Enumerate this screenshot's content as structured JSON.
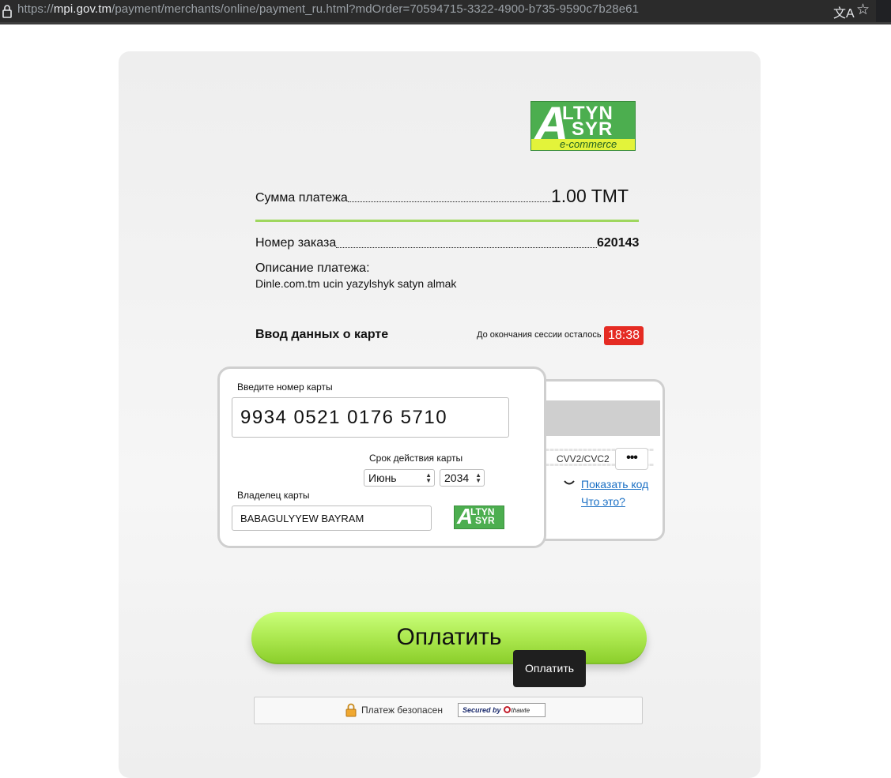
{
  "browser": {
    "url_prefix": "https://",
    "url_domain": "mpi.gov.tm",
    "url_path": "/payment/merchants/online/payment_ru.html?mdOrder=70594715-3322-4900-b735-9590c7b28e61",
    "icons": [
      "lock-icon",
      "translate-icon",
      "star-icon"
    ]
  },
  "logo": {
    "letter_a": "A",
    "line1": "LTYN",
    "line2": "SYR",
    "tagline": "e-commerce",
    "colors": {
      "green": "#4cae4f",
      "yellow": "#e3f33a"
    }
  },
  "payment": {
    "amount_label": "Сумма платежа",
    "amount_value": "1.00 TMT",
    "order_label": "Номер заказа",
    "order_value": "620143",
    "description_label": "Описание платежа:",
    "description_value": "Dinle.com.tm ucin yazylshyk satyn almak"
  },
  "card_section": {
    "title": "Ввод данных о карте",
    "session_text": "До окончания сессии осталось",
    "session_timer": "18:38",
    "timer_color": "#e52b23"
  },
  "card_front": {
    "pan_label": "Введите номер карты",
    "pan_value": "9934 0521 0176 5710",
    "expiry_label": "Срок действия карты",
    "month_value": "Июнь",
    "year_value": "2034",
    "holder_label": "Владелец карты",
    "holder_value": "BABAGULYYEW BAYRAM"
  },
  "card_back": {
    "cvv_label": "CVV2/CVC2",
    "cvv_value": "•••",
    "show_code_link": "Показать код",
    "what_link": "Что это?"
  },
  "actions": {
    "pay_label": "Оплатить",
    "tooltip": "Оплатить",
    "button_color": "#a9e64c"
  },
  "security": {
    "secure_text": "Платеж безопасен",
    "badge_prefix": "Secured by",
    "badge_brand": "thawte"
  }
}
